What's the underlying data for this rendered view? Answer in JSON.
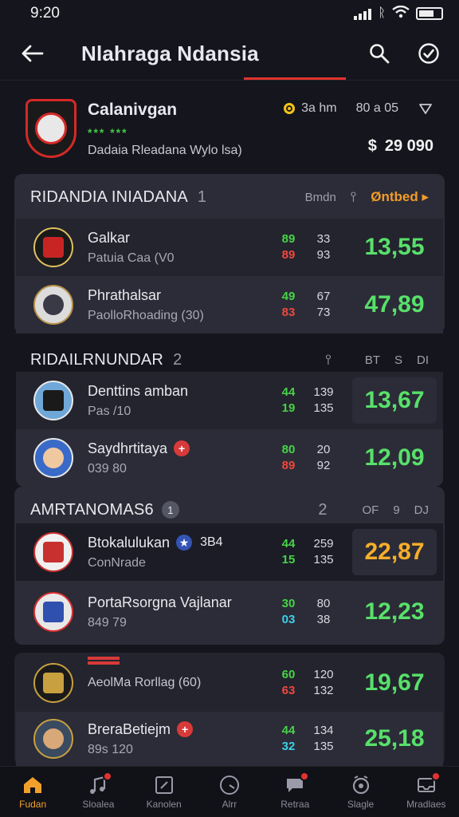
{
  "status": {
    "time": "9:20"
  },
  "header": {
    "title": "Nlahraga Ndansia"
  },
  "featured": {
    "name": "Calanivgan",
    "tag": "*** ***",
    "sub": "Dadaia Rleadana Wylo lsa)",
    "time": "3a hm",
    "code": "80 a 05",
    "price": "29 090",
    "price_icon": "$",
    "colors": {
      "crest": "#d42a26",
      "time_dot": "#f4c218"
    }
  },
  "sections": [
    {
      "title": "RIDANDIA INIADANA",
      "count": "1",
      "right_label": "Bmdn",
      "link": "Øntbed ▸"
    },
    {
      "title": "RIDAILRNUNDAR",
      "count": "2",
      "right_cols": [
        "BT",
        "S",
        "DI"
      ]
    },
    {
      "title": "AMRTANOMAS6",
      "count_pill": "1",
      "count": "2",
      "right_cols": [
        "OF",
        "9",
        "DJ"
      ]
    }
  ],
  "rows": [
    {
      "name": "Galkar",
      "sub": "Patuia Caa (V0",
      "s1a": "89",
      "s1b": "89",
      "s2a": "33",
      "s2b": "93",
      "score": "13,55"
    },
    {
      "name": "Phrathalsar",
      "sub": "PaolloRhoading (30)",
      "s1a": "49",
      "s1b": "83",
      "s2a": "67",
      "s2b": "73",
      "score": "47,89"
    },
    {
      "name": "Denttins amban",
      "sub": "Pas /10",
      "s1a": "44",
      "s1b": "19",
      "s2a": "139",
      "s2b": "135",
      "score": "13,67"
    },
    {
      "name": "Saydhrtitaya",
      "sub": "039 80",
      "s1a": "80",
      "s1b": "89",
      "s2a": "20",
      "s2b": "92",
      "score": "12,09"
    },
    {
      "name": "Btokalulukan",
      "extra": "3B4",
      "sub": "ConNrade",
      "s1a": "44",
      "s1b": "15",
      "s2a": "259",
      "s2b": "135",
      "score": "22,87"
    },
    {
      "name": "PortaRsorgna Vajlanar",
      "sub": "849 79",
      "s1a": "30",
      "s1b": "03",
      "s2a": "80",
      "s2b": "38",
      "score": "12,23"
    },
    {
      "name": "",
      "sub": "AeolMa Rorllag (60)",
      "s1a": "60",
      "s1b": "63",
      "s2a": "120",
      "s2b": "132",
      "score": "19,67"
    },
    {
      "name": "BreraBetiejm",
      "sub": "89s 120",
      "s1a": "44",
      "s1b": "32",
      "s2a": "134",
      "s2b": "135",
      "score": "25,18"
    }
  ],
  "nav": [
    {
      "label": "Fudan",
      "icon": "home-icon",
      "active": true
    },
    {
      "label": "Sloalea",
      "icon": "music-icon"
    },
    {
      "label": "Kanolen",
      "icon": "calendar-icon"
    },
    {
      "label": "Alrr",
      "icon": "clock-icon"
    },
    {
      "label": "Retraa",
      "icon": "chat-icon"
    },
    {
      "label": "Slagle",
      "icon": "alarm-icon"
    },
    {
      "label": "Mradlaes",
      "icon": "inbox-icon"
    }
  ]
}
